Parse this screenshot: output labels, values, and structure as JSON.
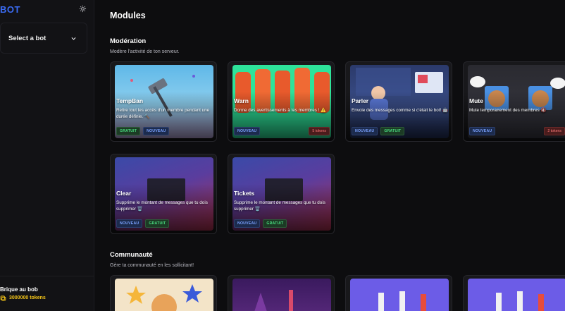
{
  "sidebar": {
    "brand": "BOT",
    "select_bot": "Select a bot",
    "user": {
      "name": "Brique au bob",
      "tokens": "3000000 tokens"
    }
  },
  "main": {
    "title": "Modules",
    "sections": [
      {
        "title": "Modération",
        "subtitle": "Modère l'activité de ton serveur.",
        "cards": [
          {
            "title": "TempBan",
            "description": "Retire tout les accès d'un membre pendant une durée définie. 🔨",
            "tags": [
              "GRATUIT",
              "NOUVEAU"
            ],
            "tokens": ""
          },
          {
            "title": "Warn",
            "description": "Donne des avertissements à tes membres ! ⚠️",
            "tags": [
              "NOUVEAU"
            ],
            "tokens": "5 tokens"
          },
          {
            "title": "Parler",
            "description": "Envoie des messages comme si c'était le bot! 🤖",
            "tags": [
              "NOUVEAU",
              "GRATUIT"
            ],
            "tokens": ""
          },
          {
            "title": "Mute",
            "description": "Mute temporairement des membres 🔇",
            "tags": [
              "NOUVEAU"
            ],
            "tokens": "2 tokens"
          },
          {
            "title": "Clear",
            "description": "Supprime le montant de messages que tu dois supprimer 🗑️",
            "tags": [
              "NOUVEAU",
              "GRATUIT"
            ],
            "tokens": ""
          },
          {
            "title": "Tickets",
            "description": "Supprime le montant de messages que tu dois supprimer 🗑️",
            "tags": [
              "NOUVEAU",
              "GRATUIT"
            ],
            "tokens": ""
          }
        ]
      },
      {
        "title": "Communauté",
        "subtitle": "Gère ta communauté en les sollicitant!"
      }
    ]
  },
  "colors": {
    "brand": "#3b6cf5",
    "tokens": "#f5c518",
    "gratuit": "#4ade80",
    "nouveau": "#7aa2ff",
    "tokens_badge": "#ff7a7a"
  },
  "icons": {
    "theme": "sun-icon",
    "select": "chevron-down-icon",
    "tokens": "coin-icon"
  }
}
